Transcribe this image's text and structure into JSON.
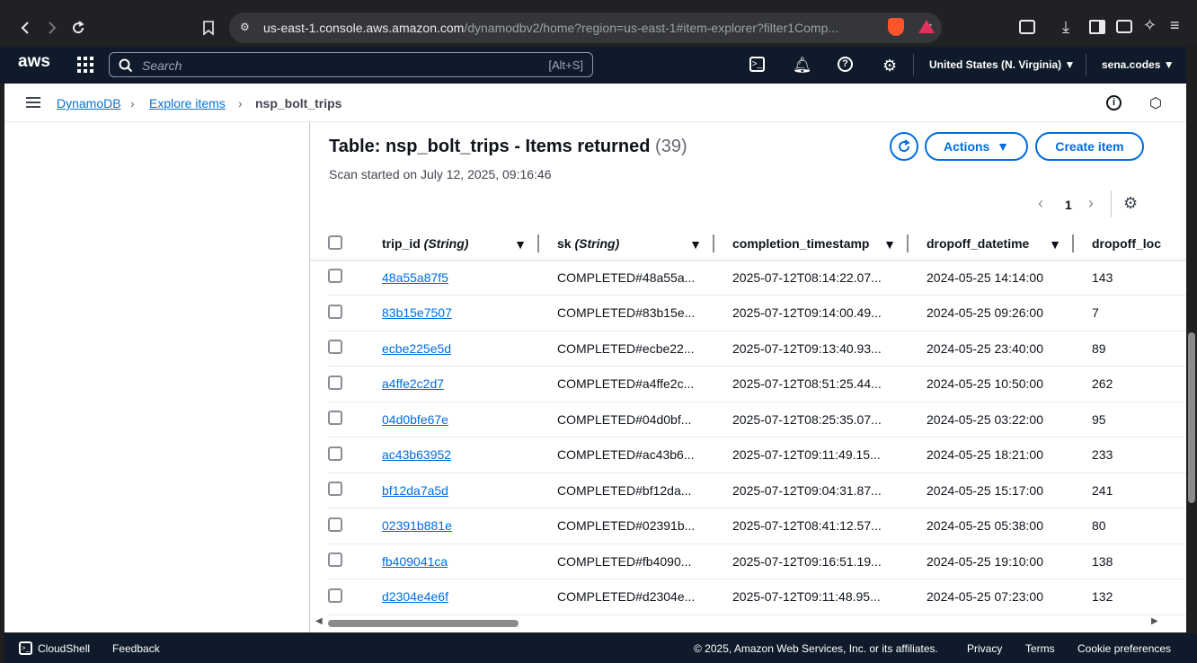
{
  "browser": {
    "url_host": "us-east-1.console.aws.amazon.com",
    "url_rest": "/dynamodbv2/home?region=us-east-1#item-explorer?filter1Comp..."
  },
  "aws_nav": {
    "logo": "aws",
    "search_placeholder": "Search",
    "search_shortcut": "[Alt+S]",
    "region": "United States (N. Virginia)",
    "account": "sena.codes"
  },
  "breadcrumbs": {
    "service": "DynamoDB",
    "explore": "Explore items",
    "current": "nsp_bolt_trips"
  },
  "panel": {
    "title": "Table: nsp_bolt_trips - Items returned",
    "count": "(39)",
    "subtitle": "Scan started on July 12, 2025, 09:16:46",
    "actions_label": "Actions",
    "create_label": "Create item",
    "page_number": "1"
  },
  "table": {
    "columns": [
      {
        "name": "trip_id",
        "type": "(String)"
      },
      {
        "name": "sk",
        "type": "(String)"
      },
      {
        "name": "completion_timestamp",
        "type": ""
      },
      {
        "name": "dropoff_datetime",
        "type": ""
      },
      {
        "name": "dropoff_loc",
        "type": ""
      }
    ],
    "rows": [
      {
        "trip_id": "48a55a87f5",
        "sk": "COMPLETED#48a55a...",
        "completion_timestamp": "2025-07-12T08:14:22.07...",
        "dropoff_datetime": "2024-05-25 14:14:00",
        "dropoff_loc": "143"
      },
      {
        "trip_id": "83b15e7507",
        "sk": "COMPLETED#83b15e...",
        "completion_timestamp": "2025-07-12T09:14:00.49...",
        "dropoff_datetime": "2024-05-25 09:26:00",
        "dropoff_loc": "7"
      },
      {
        "trip_id": "ecbe225e5d",
        "sk": "COMPLETED#ecbe22...",
        "completion_timestamp": "2025-07-12T09:13:40.93...",
        "dropoff_datetime": "2024-05-25 23:40:00",
        "dropoff_loc": "89"
      },
      {
        "trip_id": "a4ffe2c2d7",
        "sk": "COMPLETED#a4ffe2c...",
        "completion_timestamp": "2025-07-12T08:51:25.44...",
        "dropoff_datetime": "2024-05-25 10:50:00",
        "dropoff_loc": "262"
      },
      {
        "trip_id": "04d0bfe67e",
        "sk": "COMPLETED#04d0bf...",
        "completion_timestamp": "2025-07-12T08:25:35.07...",
        "dropoff_datetime": "2024-05-25 03:22:00",
        "dropoff_loc": "95"
      },
      {
        "trip_id": "ac43b63952",
        "sk": "COMPLETED#ac43b6...",
        "completion_timestamp": "2025-07-12T09:11:49.15...",
        "dropoff_datetime": "2024-05-25 18:21:00",
        "dropoff_loc": "233"
      },
      {
        "trip_id": "bf12da7a5d",
        "sk": "COMPLETED#bf12da...",
        "completion_timestamp": "2025-07-12T09:04:31.87...",
        "dropoff_datetime": "2024-05-25 15:17:00",
        "dropoff_loc": "241"
      },
      {
        "trip_id": "02391b881e",
        "sk": "COMPLETED#02391b...",
        "completion_timestamp": "2025-07-12T08:41:12.57...",
        "dropoff_datetime": "2024-05-25 05:38:00",
        "dropoff_loc": "80"
      },
      {
        "trip_id": "fb409041ca",
        "sk": "COMPLETED#fb4090...",
        "completion_timestamp": "2025-07-12T09:16:51.19...",
        "dropoff_datetime": "2024-05-25 19:10:00",
        "dropoff_loc": "138"
      },
      {
        "trip_id": "d2304e4e6f",
        "sk": "COMPLETED#d2304e...",
        "completion_timestamp": "2025-07-12T09:11:48.95...",
        "dropoff_datetime": "2024-05-25 07:23:00",
        "dropoff_loc": "132"
      }
    ]
  },
  "footer": {
    "cloudshell": "CloudShell",
    "feedback": "Feedback",
    "copyright": "© 2025, Amazon Web Services, Inc. or its affiliates.",
    "privacy": "Privacy",
    "terms": "Terms",
    "cookies": "Cookie preferences"
  },
  "colors": {
    "accent": "#006ce0",
    "nav_bg": "#0f1b2a"
  }
}
